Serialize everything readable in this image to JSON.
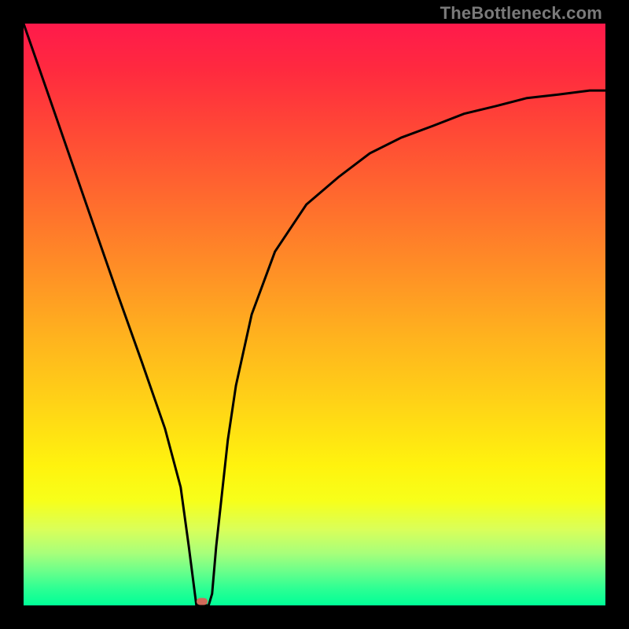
{
  "watermark": "TheBottleneck.com",
  "colors": {
    "frame": "#000000",
    "curve": "#000000",
    "marker": "#d06a5a",
    "gradient_top": "#ff1a4b",
    "gradient_bottom": "#00ff97"
  },
  "chart_data": {
    "type": "line",
    "title": "",
    "xlabel": "",
    "ylabel": "",
    "xlim": [
      0,
      100
    ],
    "ylim": [
      0,
      100
    ],
    "grid": false,
    "legend": false,
    "series": [
      {
        "name": "bottleneck-curve",
        "x": [
          0,
          5.4,
          10.8,
          16.2,
          20.3,
          24.3,
          27.0,
          28.4,
          29.7,
          31.8,
          32.4,
          33.1,
          35.1,
          36.5,
          39.2,
          43.2,
          48.6,
          54.1,
          59.5,
          64.9,
          70.3,
          75.7,
          81.1,
          86.5,
          91.9,
          97.3,
          100.0
        ],
        "y": [
          100.0,
          84.5,
          68.9,
          53.4,
          41.9,
          30.4,
          20.3,
          10.1,
          0.0,
          0.0,
          2.0,
          10.1,
          28.4,
          37.8,
          50.0,
          60.8,
          68.9,
          73.6,
          77.7,
          80.4,
          82.4,
          84.5,
          85.8,
          87.2,
          87.8,
          88.5,
          88.5
        ]
      }
    ],
    "marker": {
      "x": 30.7,
      "y": 0.7
    },
    "annotations": []
  }
}
